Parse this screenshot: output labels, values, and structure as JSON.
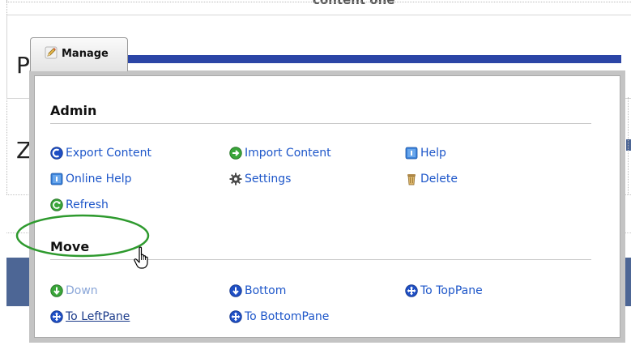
{
  "background": {
    "heading_text": "content one",
    "letter_1": "P",
    "letter_2": "Z"
  },
  "manage_tab": {
    "label": "Manage",
    "icon": "pencil-icon"
  },
  "menu": {
    "admin": {
      "title": "Admin",
      "items": [
        {
          "label": "Export Content",
          "icon": "export-icon",
          "color": "#1d56c9"
        },
        {
          "label": "Import Content",
          "icon": "import-icon",
          "color": "#1d56c9"
        },
        {
          "label": "Help",
          "icon": "help-icon",
          "color": "#1d56c9"
        },
        {
          "label": "Online Help",
          "icon": "online-help-icon",
          "color": "#1d56c9"
        },
        {
          "label": "Settings",
          "icon": "gear-icon",
          "color": "#1d56c9"
        },
        {
          "label": "Delete",
          "icon": "trash-icon",
          "color": "#1d56c9"
        },
        {
          "label": "Refresh",
          "icon": "refresh-icon",
          "color": "#1d56c9"
        }
      ]
    },
    "move": {
      "title": "Move",
      "items": [
        {
          "label": "Down",
          "icon": "arrow-down-icon",
          "state": "partially-hidden"
        },
        {
          "label": "Bottom",
          "icon": "arrow-down-circle-icon"
        },
        {
          "label": "To TopPane",
          "icon": "move-icon"
        },
        {
          "label": "To LeftPane",
          "icon": "move-icon",
          "state": "hovered"
        },
        {
          "label": "To BottomPane",
          "icon": "move-icon"
        }
      ]
    }
  },
  "annotation": {
    "highlight": "green-ellipse",
    "highlight_color": "#2e9a2e",
    "cursor": "hand-pointer-icon"
  },
  "colors": {
    "link": "#1d56c9",
    "panel_border": "#c4c4c4",
    "accent_bar": "#2b45a6",
    "nav_bar": "#4d6695"
  }
}
